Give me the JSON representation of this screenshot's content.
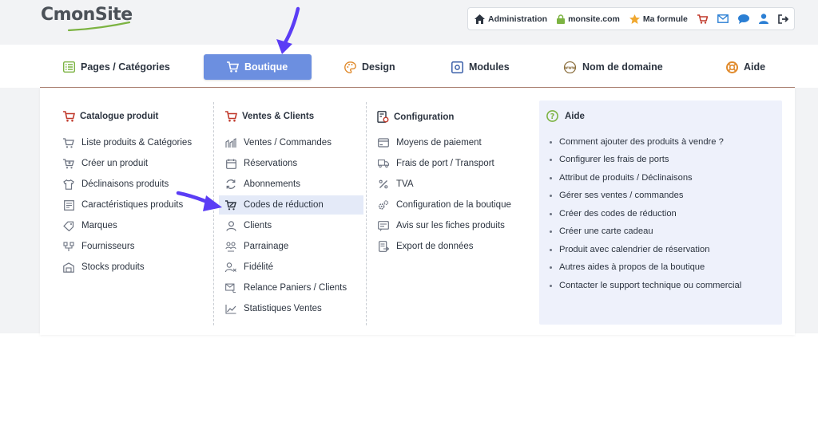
{
  "brand": {
    "logo_text": "CmonSite"
  },
  "toolbar": {
    "administration": "Administration",
    "site": "monsite.com",
    "plan": "Ma formule"
  },
  "nav": {
    "items": [
      {
        "label": "Pages / Catégories",
        "icon": "list-icon"
      },
      {
        "label": "Boutique",
        "icon": "cart-icon",
        "active": true
      },
      {
        "label": "Design",
        "icon": "palette-icon"
      },
      {
        "label": "Modules",
        "icon": "module-icon"
      },
      {
        "label": "Nom de domaine",
        "icon": "www-icon"
      },
      {
        "label": "Aide",
        "icon": "lifebuoy-icon"
      }
    ]
  },
  "menu": {
    "catalogue": {
      "title": "Catalogue produit",
      "items": [
        "Liste produits & Catégories",
        "Créer un produit",
        "Déclinaisons produits",
        "Caractéristiques produits",
        "Marques",
        "Fournisseurs",
        "Stocks produits"
      ]
    },
    "ventes": {
      "title": "Ventes & Clients",
      "items": [
        "Ventes / Commandes",
        "Réservations",
        "Abonnements",
        "Codes de réduction",
        "Clients",
        "Parrainage",
        "Fidélité",
        "Relance Paniers / Clients",
        "Statistiques Ventes"
      ],
      "highlighted": "Codes de réduction"
    },
    "configuration": {
      "title": "Configuration",
      "items": [
        "Moyens de paiement",
        "Frais de port / Transport",
        "TVA",
        "Configuration de la boutique",
        "Avis sur les fiches produits",
        "Export de données"
      ]
    },
    "aide": {
      "title": "Aide",
      "items": [
        "Comment ajouter des produits à vendre ?",
        "Configurer les frais de ports",
        "Attribut de produits / Déclinaisons",
        "Gérer ses ventes / commandes",
        "Créer des codes de réduction",
        "Créer une carte cadeau",
        "Produit avec calendrier de réservation",
        "Autres aides à propos de la boutique",
        "Contacter le support technique ou commercial"
      ]
    }
  },
  "colors": {
    "accent": "#6c8fe0",
    "cart_red": "#c0392b",
    "arrow": "#5b3df5",
    "help_bg": "#eef1fb"
  }
}
